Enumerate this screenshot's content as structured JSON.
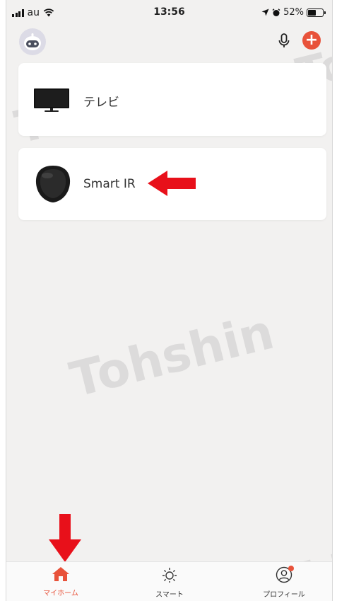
{
  "status_bar": {
    "carrier": "au",
    "time": "13:56",
    "battery": "52%"
  },
  "devices": [
    {
      "name": "テレビ",
      "icon": "tv-icon"
    },
    {
      "name": "Smart IR",
      "icon": "smart-ir-icon"
    }
  ],
  "watermark": {
    "text": "Tohshin"
  },
  "tabs": [
    {
      "label": "マイホーム",
      "icon": "home-icon",
      "active": true
    },
    {
      "label": "スマート",
      "icon": "sun-icon"
    },
    {
      "label": "プロフィール",
      "icon": "profile-icon"
    }
  ],
  "colors": {
    "accent": "#e8523a",
    "annotation_arrow": "#e8101a",
    "background": "#f2f1f0"
  }
}
